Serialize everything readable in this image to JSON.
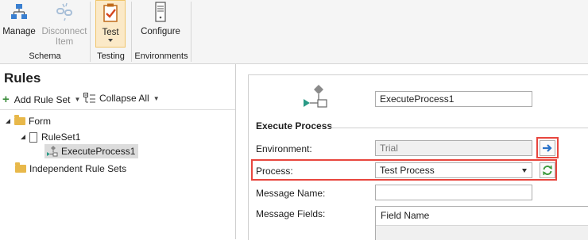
{
  "ribbon": {
    "buttons": {
      "manage": "Manage",
      "disconnect_line1": "Disconnect",
      "disconnect_line2": "Item",
      "test": "Test",
      "configure": "Configure"
    },
    "groups": [
      "Schema",
      "Testing",
      "Environments"
    ],
    "icons": {
      "manage": "sitemap-icon",
      "disconnect": "broken-link-icon",
      "test": "clipboard-check-icon",
      "configure": "server-icon"
    }
  },
  "left_pane": {
    "title": "Rules",
    "toolbar": {
      "add_rule_set": "Add Rule Set",
      "collapse_all": "Collapse All"
    },
    "tree": {
      "form": "Form",
      "ruleset1": "RuleSet1",
      "execute_process1": "ExecuteProcess1",
      "independent": "Independent Rule Sets"
    }
  },
  "right_pane": {
    "name_value": "ExecuteProcess1",
    "section_title": "Execute Process",
    "environment_label": "Environment:",
    "environment_value": "Trial",
    "process_label": "Process:",
    "process_value": "Test Process",
    "message_name_label": "Message Name:",
    "message_name_value": "",
    "message_fields_label": "Message Fields:",
    "grid_header": "Field Name"
  },
  "colors": {
    "highlight_red": "#e8463e",
    "folder": "#e8b84a",
    "arrow_blue": "#2a72c9",
    "refresh_green": "#3c9a3c"
  }
}
